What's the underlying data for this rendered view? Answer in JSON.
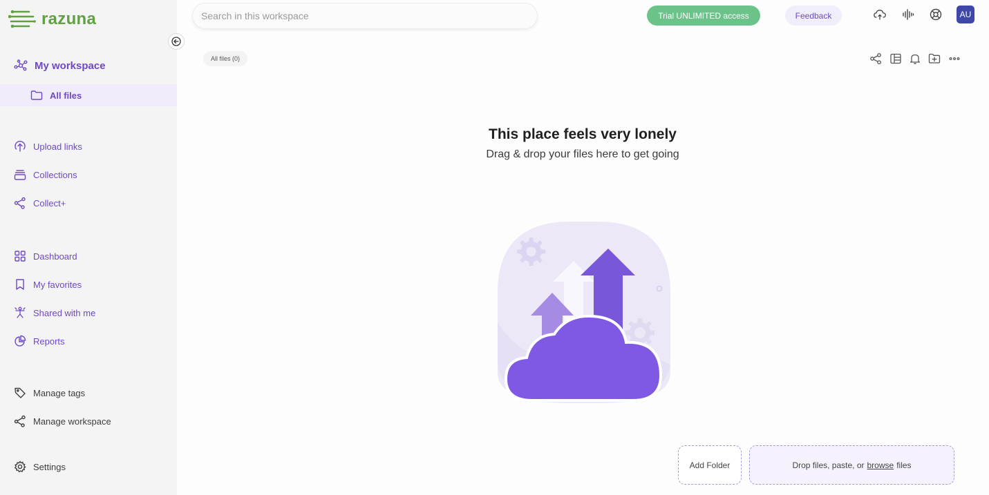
{
  "app": {
    "logo_text": "razuna",
    "brand_color": "#62a045",
    "accent": "#6e48c7"
  },
  "search": {
    "placeholder": "Search in this workspace"
  },
  "header": {
    "trial_label": "Trial UNLIMITED access",
    "feedback_label": "Feedback",
    "avatar_initials": "AU",
    "icons": [
      "cloud-sync-icon",
      "audio-wave-icon",
      "help-lifebuoy-icon"
    ]
  },
  "sidebar": {
    "workspace_label": "My workspace",
    "all_files_label": "All files",
    "items": [
      {
        "label": "Upload links",
        "icon": "upload-icon"
      },
      {
        "label": "Collections",
        "icon": "collections-icon"
      },
      {
        "label": "Collect+",
        "icon": "collect-plus-icon"
      },
      {
        "label": "Dashboard",
        "icon": "dashboard-icon"
      },
      {
        "label": "My favorites",
        "icon": "bookmark-icon"
      },
      {
        "label": "Shared with me",
        "icon": "shared-icon"
      },
      {
        "label": "Reports",
        "icon": "pie-chart-icon"
      },
      {
        "label": "Manage tags",
        "icon": "tag-icon"
      },
      {
        "label": "Manage workspace",
        "icon": "share-nodes-icon"
      },
      {
        "label": "Settings",
        "icon": "gear-icon"
      }
    ]
  },
  "breadcrumb": {
    "label": "All files (0)"
  },
  "toolbar": {
    "icons": [
      "share-icon",
      "table-view-icon",
      "bell-icon",
      "new-folder-icon",
      "more-icon"
    ]
  },
  "empty_state": {
    "title": "This place feels very lonely",
    "subtitle": "Drag & drop your files here to get going"
  },
  "actions": {
    "add_folder_label": "Add Folder",
    "drop_prefix": "Drop files, paste, or",
    "browse_label": "browse",
    "drop_suffix": "files"
  }
}
